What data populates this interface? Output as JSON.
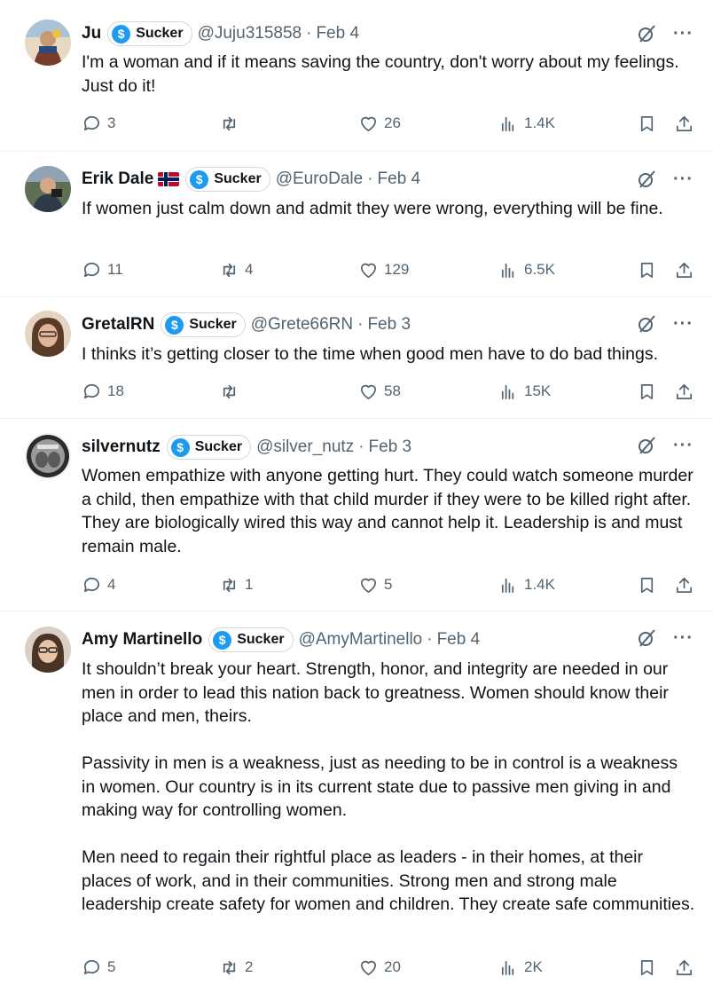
{
  "tweets": [
    {
      "name": "Ju",
      "has_flag": false,
      "badge": "Sucker",
      "handle": "@Juju315858",
      "dot": "·",
      "date": "Feb 4",
      "paragraphs": [
        "I'm a woman and if it means saving the country, don't worry about my feelings. Just do it!"
      ],
      "replies": "3",
      "retweets": "",
      "likes": "26",
      "views": "1.4K",
      "avatar_color": "#7a5a3c"
    },
    {
      "name": "Erik Dale",
      "has_flag": true,
      "badge": "Sucker",
      "handle": "@EuroDale",
      "dot": "·",
      "date": "Feb 4",
      "paragraphs": [
        "If women just calm down and admit they were wrong, everything will be fine."
      ],
      "replies": "11",
      "retweets": "4",
      "likes": "129",
      "views": "6.5K",
      "avatar_color": "#4a5a6a"
    },
    {
      "name": "GretalRN",
      "has_flag": false,
      "badge": "Sucker",
      "handle": "@Grete66RN",
      "dot": "·",
      "date": "Feb 3",
      "paragraphs": [
        "I thinks it’s getting closer to the time when good men have to do bad things."
      ],
      "replies": "18",
      "retweets": "",
      "likes": "58",
      "views": "15K",
      "avatar_color": "#c9a68a"
    },
    {
      "name": "silvernutz",
      "has_flag": false,
      "badge": "Sucker",
      "handle": "@silver_nutz",
      "dot": "·",
      "date": "Feb 3",
      "paragraphs": [
        "Women empathize with anyone getting hurt.  They could watch someone murder a child, then empathize with that child murder if they were to be killed right after.  They are biologically wired this way and cannot help it.  Leadership is and must remain male."
      ],
      "replies": "4",
      "retweets": "1",
      "likes": "5",
      "views": "1.4K",
      "avatar_color": "#8a8a8a"
    },
    {
      "name": "Amy Martinello",
      "has_flag": false,
      "badge": "Sucker",
      "handle": "@AmyMartinello",
      "dot": "·",
      "date": "Feb 4",
      "paragraphs": [
        "It shouldn’t break your heart. Strength, honor, and integrity are needed in our men in order to lead this nation back to greatness. Women should know their place and men, theirs.",
        "Passivity in men is a weakness, just as needing to be in control is a weakness in women. Our country is in its current state due to passive men giving in and making way for controlling women.",
        "Men need to regain their rightful place as leaders - in their homes, at their places of work, and in their communities. Strong men and strong male leadership create safety for women and children. They create safe communities."
      ],
      "replies": "5",
      "retweets": "2",
      "likes": "20",
      "views": "2K",
      "avatar_color": "#6b5a4a"
    }
  ],
  "icons": {
    "coin": "$",
    "more": "···"
  },
  "colors": {
    "text": "#0f1419",
    "secondary": "#536471",
    "divider": "#eff3f4",
    "badge_blue": "#1d9bf0"
  }
}
